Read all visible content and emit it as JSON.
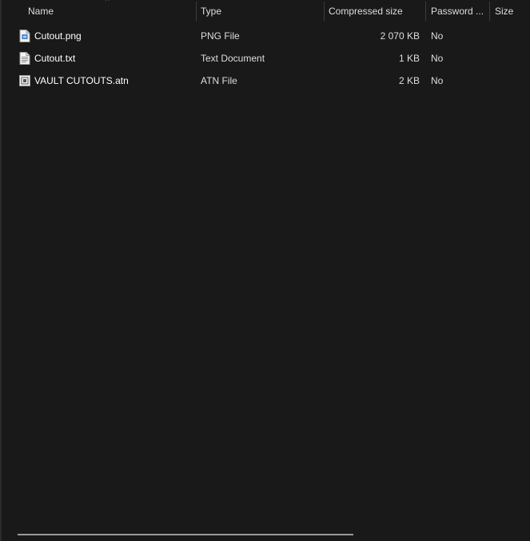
{
  "columns": {
    "name": "Name",
    "type": "Type",
    "compressed_size": "Compressed size",
    "password": "Password ...",
    "size": "Size"
  },
  "sort_indicator": "^",
  "files": [
    {
      "name": "Cutout.png",
      "type": "PNG File",
      "compressed_size": "2 070 KB",
      "password": "No",
      "icon": "png-file-icon"
    },
    {
      "name": "Cutout.txt",
      "type": "Text Document",
      "compressed_size": "1 KB",
      "password": "No",
      "icon": "text-file-icon"
    },
    {
      "name": "VAULT CUTOUTS.atn",
      "type": "ATN File",
      "compressed_size": "2 KB",
      "password": "No",
      "icon": "atn-file-icon"
    }
  ],
  "colors": {
    "background": "#191919",
    "text": "#ffffff",
    "header_text": "#dedede",
    "separator": "#3c3c3c",
    "png_icon_accent": "#2f7fd6"
  }
}
